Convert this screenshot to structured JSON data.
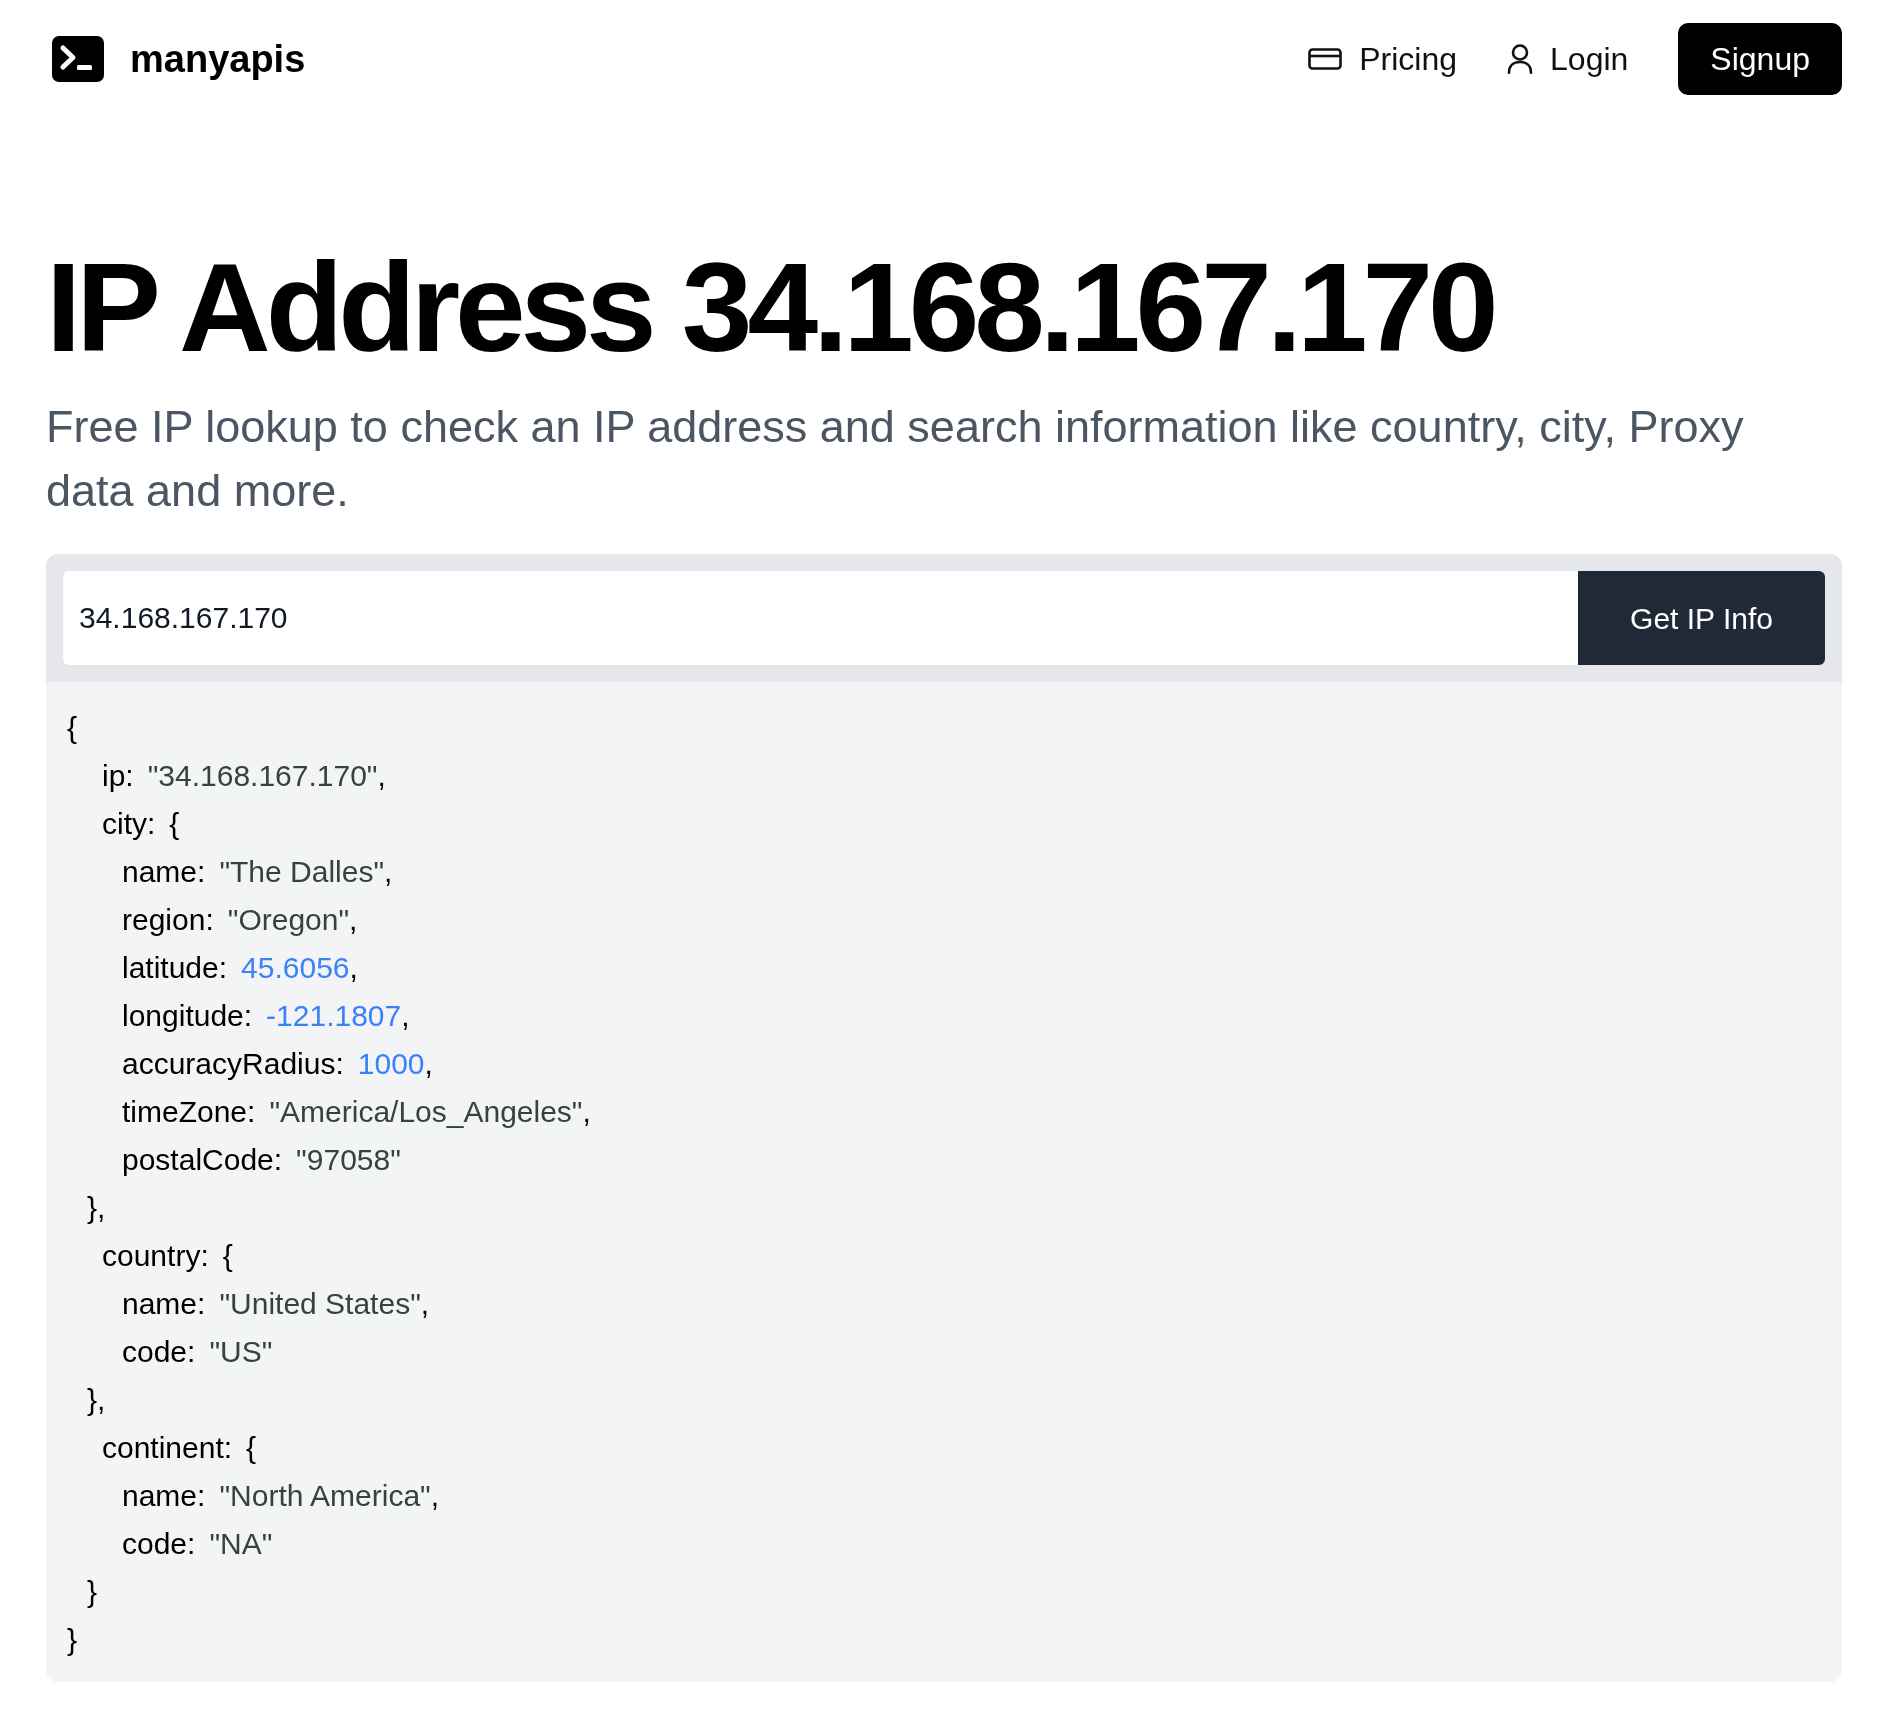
{
  "header": {
    "brand": "manyapis",
    "nav": [
      {
        "label": "Pricing"
      },
      {
        "label": "Login"
      }
    ],
    "signup": "Signup"
  },
  "hero": {
    "title": "IP Address 34.168.167.170",
    "subtitle": "Free IP lookup to check an IP address and search information like country, city, Proxy data and more."
  },
  "lookup": {
    "input_value": "34.168.167.170",
    "button": "Get IP Info"
  },
  "result": {
    "open": "{",
    "entries": [
      {
        "key": "ip:",
        "value": "\"34.168.167.170\"",
        "kind": "string",
        "trailer": ","
      },
      {
        "key": "city:",
        "kind": "object",
        "open": "{",
        "children": [
          {
            "key": "name:",
            "value": "\"The Dalles\"",
            "kind": "string",
            "trailer": ","
          },
          {
            "key": "region:",
            "value": "\"Oregon\"",
            "kind": "string",
            "trailer": ","
          },
          {
            "key": "latitude:",
            "value": "45.6056",
            "kind": "number",
            "trailer": ","
          },
          {
            "key": "longitude:",
            "value": "-121.1807",
            "kind": "number",
            "trailer": ","
          },
          {
            "key": "accuracyRadius:",
            "value": "1000",
            "kind": "number",
            "trailer": ","
          },
          {
            "key": "timeZone:",
            "value": "\"America/Los_Angeles\"",
            "kind": "string",
            "trailer": ","
          },
          {
            "key": "postalCode:",
            "value": "\"97058\"",
            "kind": "string"
          }
        ],
        "close": "},"
      },
      {
        "key": "country:",
        "kind": "object",
        "open": "{",
        "children": [
          {
            "key": "name:",
            "value": "\"United States\"",
            "kind": "string",
            "trailer": ","
          },
          {
            "key": "code:",
            "value": "\"US\"",
            "kind": "string"
          }
        ],
        "close": "},"
      },
      {
        "key": "continent:",
        "kind": "object",
        "open": "{",
        "children": [
          {
            "key": "name:",
            "value": "\"North America\"",
            "kind": "string",
            "trailer": ","
          },
          {
            "key": "code:",
            "value": "\"NA\"",
            "kind": "string"
          }
        ],
        "close": "}"
      }
    ],
    "close": "}"
  }
}
